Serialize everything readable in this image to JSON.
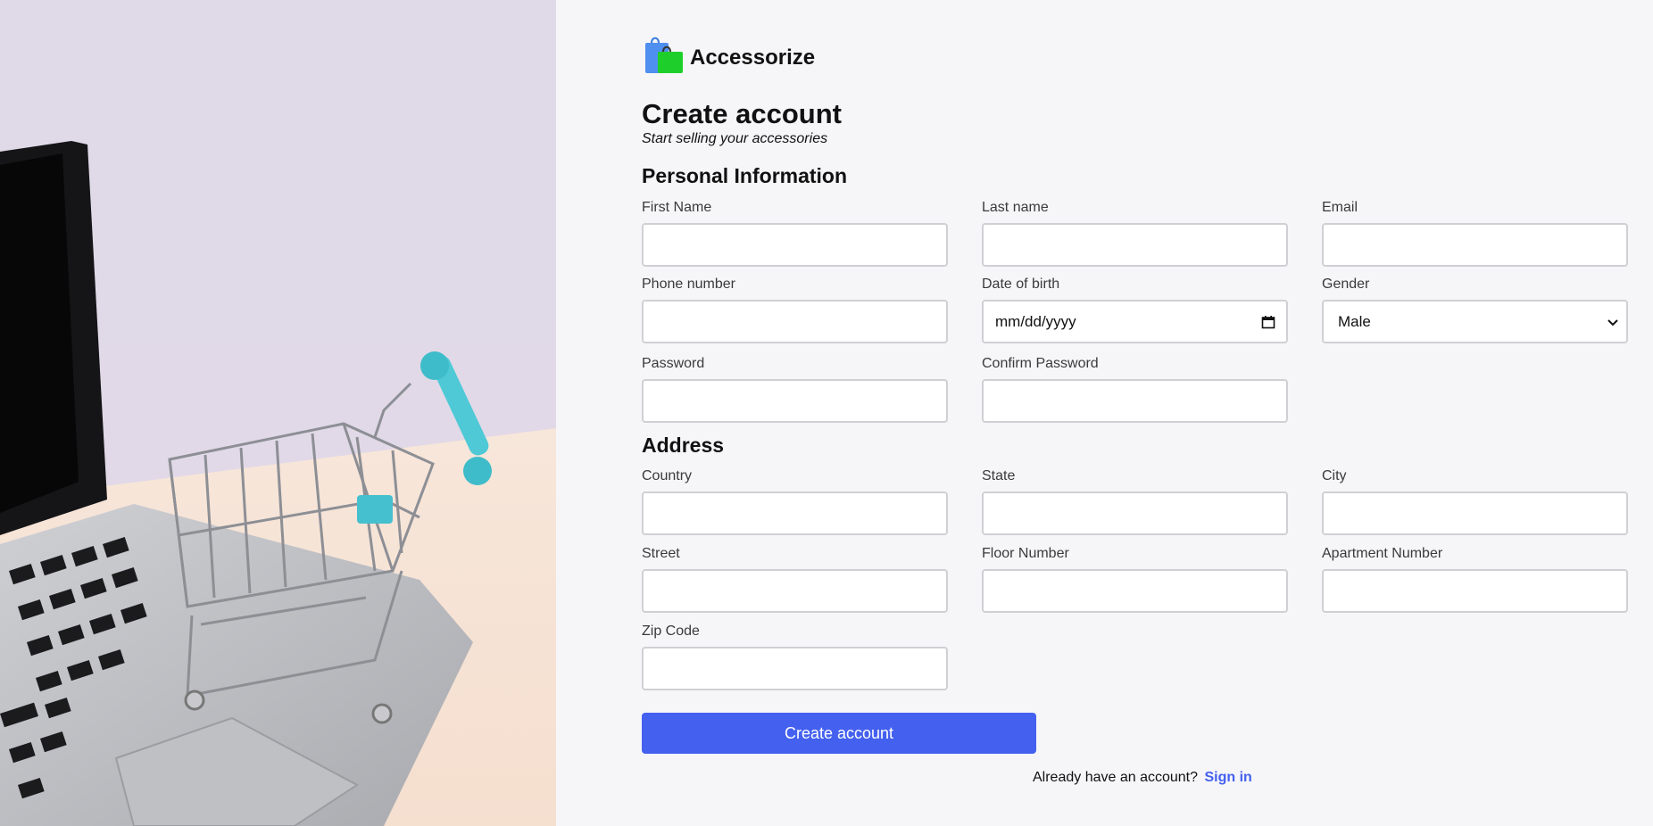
{
  "brand": {
    "name": "Accessorize"
  },
  "page": {
    "title": "Create account",
    "subtitle": "Start selling your accessories"
  },
  "sections": {
    "personal": "Personal Information",
    "address": "Address"
  },
  "fields": {
    "first_name": {
      "label": "First Name",
      "value": ""
    },
    "last_name": {
      "label": "Last name",
      "value": ""
    },
    "email": {
      "label": "Email",
      "value": ""
    },
    "phone": {
      "label": "Phone number",
      "value": ""
    },
    "dob": {
      "label": "Date of birth",
      "placeholder": "mm/dd/yyyy"
    },
    "gender": {
      "label": "Gender",
      "selected": "Male"
    },
    "password": {
      "label": "Password",
      "value": ""
    },
    "confirm_password": {
      "label": "Confirm Password",
      "value": ""
    },
    "country": {
      "label": "Country",
      "value": ""
    },
    "state": {
      "label": "State",
      "value": ""
    },
    "city": {
      "label": "City",
      "value": ""
    },
    "street": {
      "label": "Street",
      "value": ""
    },
    "floor": {
      "label": "Floor Number",
      "value": ""
    },
    "apartment": {
      "label": "Apartment Number",
      "value": ""
    },
    "zip": {
      "label": "Zip Code",
      "value": ""
    }
  },
  "actions": {
    "submit_label": "Create account",
    "signin_prompt": "Already have an account?",
    "signin_link": "Sign in"
  },
  "icons": {
    "brand_logo": "shopping-bags-icon",
    "calendar": "calendar-icon",
    "select_arrow": "chevron-down-icon"
  },
  "colors": {
    "accent": "#4460ef",
    "bag_blue": "#4f8ff0",
    "bag_green": "#1ecf2b",
    "panel_bg": "#f6f6f9"
  }
}
